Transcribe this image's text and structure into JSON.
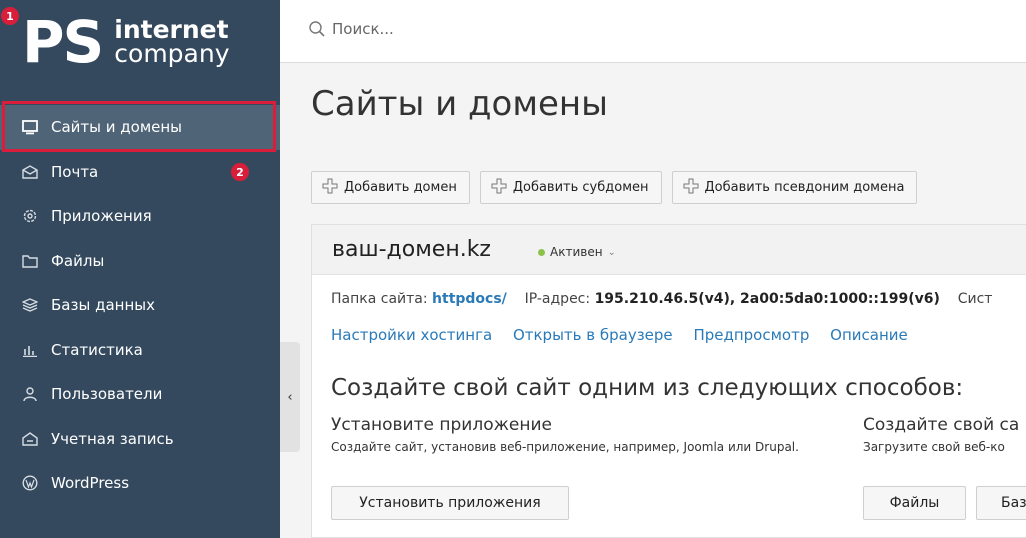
{
  "logo": {
    "ps": "PS",
    "line1": "internet",
    "line2": "company"
  },
  "badges": {
    "first": "1",
    "second": "2"
  },
  "sidebar": {
    "items": [
      {
        "label": "Сайты и домены",
        "icon": "monitor-icon"
      },
      {
        "label": "Почта",
        "icon": "mail-icon"
      },
      {
        "label": "Приложения",
        "icon": "gear-icon"
      },
      {
        "label": "Файлы",
        "icon": "folder-icon"
      },
      {
        "label": "Базы данных",
        "icon": "database-icon"
      },
      {
        "label": "Статистика",
        "icon": "chart-icon"
      },
      {
        "label": "Пользователи",
        "icon": "user-icon"
      },
      {
        "label": "Учетная запись",
        "icon": "account-icon"
      },
      {
        "label": "WordPress",
        "icon": "wordpress-icon"
      }
    ],
    "collapse": "‹"
  },
  "search": {
    "placeholder": "Поиск..."
  },
  "page_title": "Сайты и домены",
  "toolbar": {
    "add_domain": "Добавить домен",
    "add_subdomain": "Добавить субдомен",
    "add_alias": "Добавить псевдоним домена"
  },
  "domain": {
    "name": "ваш-домен.kz",
    "status": "Активен",
    "folder_label": "Папка сайта:",
    "folder_value": "httpdocs/",
    "ip_label": "IP-адрес:",
    "ip_value": "195.210.46.5(v4), 2a00:5da0:1000::199(v6)",
    "sys_label": "Сист",
    "links": [
      "Настройки хостинга",
      "Открыть в браузере",
      "Предпросмотр",
      "Описание"
    ],
    "create_title": "Создайте свой сайт одним из следующих способов:",
    "col1_title": "Установите приложение",
    "col1_text": "Создайте сайт, установив веб-приложение, например, Joomla или Drupal.",
    "col1_button": "Установить приложения",
    "col2_title": "Создайте свой са",
    "col2_text": "Загрузите свой веб-ко",
    "col2_button_files": "Файлы",
    "col2_button_db": "Баз"
  },
  "colors": {
    "sidebar": "#34495e",
    "accent": "#d81e3a",
    "link": "#2a7ab8",
    "status": "#8bc34a"
  }
}
